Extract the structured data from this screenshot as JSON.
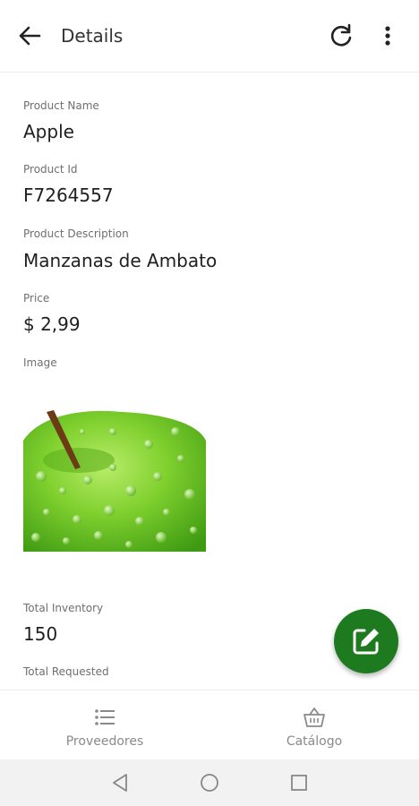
{
  "header": {
    "title": "Details",
    "back_icon": "arrow-left-icon",
    "refresh_icon": "refresh-icon",
    "menu_icon": "more-vertical-icon"
  },
  "fields": {
    "product_name": {
      "label": "Product Name",
      "value": "Apple"
    },
    "product_id": {
      "label": "Product Id",
      "value": "F7264557"
    },
    "product_description": {
      "label": "Product Description",
      "value": "Manzanas de Ambato"
    },
    "price": {
      "label": "Price",
      "value": "$ 2,99"
    },
    "image": {
      "label": "Image"
    },
    "total_inventory": {
      "label": "Total Inventory",
      "value": "150"
    },
    "total_requested": {
      "label": "Total Requested"
    }
  },
  "fab": {
    "icon": "edit-icon",
    "color": "#1e7a1e"
  },
  "bottom_nav": {
    "items": [
      {
        "label": "Proveedores",
        "icon": "list-icon"
      },
      {
        "label": "Catálogo",
        "icon": "basket-icon"
      }
    ]
  },
  "system_nav": {
    "back": "triangle-back-icon",
    "home": "circle-home-icon",
    "recents": "square-recents-icon"
  }
}
